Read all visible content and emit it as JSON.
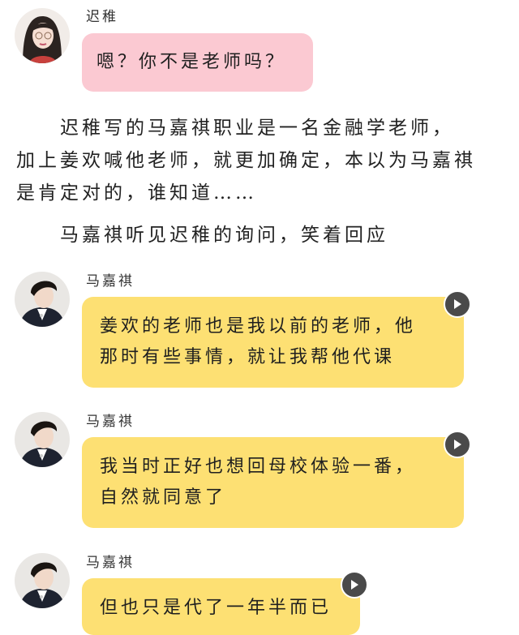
{
  "messages": [
    {
      "speaker": "迟稚",
      "text": "嗯？你不是老师吗？",
      "avatar": "girl-avatar"
    },
    {
      "speaker": "马嘉祺",
      "text_line1": "姜欢的老师也是我以前的老师，他",
      "text_line2": "那时有些事情，就让我帮他代课",
      "avatar": "boy-avatar"
    },
    {
      "speaker": "马嘉祺",
      "text_line1": "我当时正好也想回母校体验一番，",
      "text_line2": "自然就同意了",
      "avatar": "boy-avatar"
    },
    {
      "speaker": "马嘉祺",
      "text_line1": "但也只是代了一年半而已",
      "avatar": "boy-avatar"
    }
  ],
  "narration": {
    "line1": "　　迟稚写的马嘉祺职业是一名金融学老师，",
    "line2": "加上姜欢喊他老师，就更加确定，本以为马嘉祺",
    "line3": "是肯定对的，谁知道……",
    "line4": "　　马嘉祺听见迟稚的询问，笑着回应"
  },
  "colors": {
    "pink_bubble": "#fbc9d2",
    "yellow_bubble": "#fde073",
    "play_button": "#4a4a4a"
  }
}
